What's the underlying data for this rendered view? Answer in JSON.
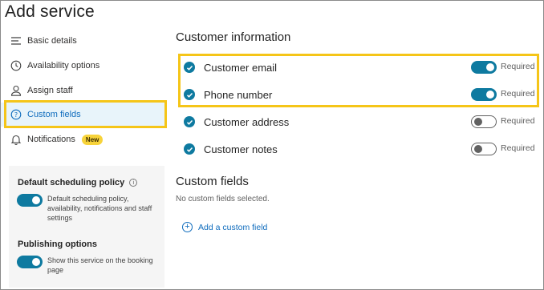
{
  "page_title": "Add service",
  "nav": {
    "items": [
      {
        "label": "Basic details",
        "icon": "list-icon"
      },
      {
        "label": "Availability options",
        "icon": "clock-icon"
      },
      {
        "label": "Assign staff",
        "icon": "person-icon"
      },
      {
        "label": "Custom fields",
        "icon": "question-icon",
        "active": true
      },
      {
        "label": "Notifications",
        "icon": "bell-icon",
        "badge": "New"
      }
    ]
  },
  "policy_panel": {
    "default_title": "Default scheduling policy",
    "default_desc": "Default scheduling policy, availability, notifications and staff settings",
    "default_on": true,
    "publishing_title": "Publishing options",
    "publishing_desc": "Show this service on the booking page",
    "publishing_on": true
  },
  "customer_info": {
    "title": "Customer information",
    "fields": [
      {
        "label": "Customer email",
        "required_label": "Required",
        "required": true
      },
      {
        "label": "Phone number",
        "required_label": "Required",
        "required": true
      },
      {
        "label": "Customer address",
        "required_label": "Required",
        "required": false
      },
      {
        "label": "Customer notes",
        "required_label": "Required",
        "required": false
      }
    ]
  },
  "custom_fields": {
    "title": "Custom fields",
    "empty_text": "No custom fields selected.",
    "add_label": "Add a custom field"
  },
  "colors": {
    "accent": "#0e7aa0",
    "highlight": "#f5c518",
    "link": "#0f6cbd"
  }
}
